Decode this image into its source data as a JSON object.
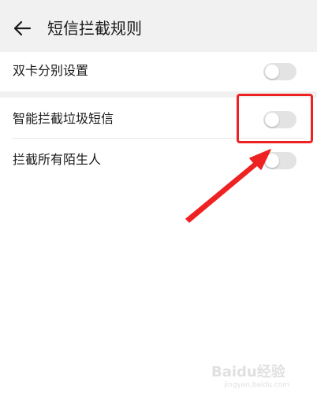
{
  "header": {
    "back_icon": "arrow-left-icon",
    "title": "短信拦截规则"
  },
  "settings": [
    {
      "label": "双卡分别设置",
      "enabled": false
    },
    {
      "label": "智能拦截垃圾短信",
      "enabled": false
    },
    {
      "label": "拦截所有陌生人",
      "enabled": false
    }
  ],
  "annotation": {
    "highlight_color": "#ee2222"
  },
  "watermark": {
    "logo_text": "Baidu经验",
    "url": "jingyan.baidu.com"
  }
}
